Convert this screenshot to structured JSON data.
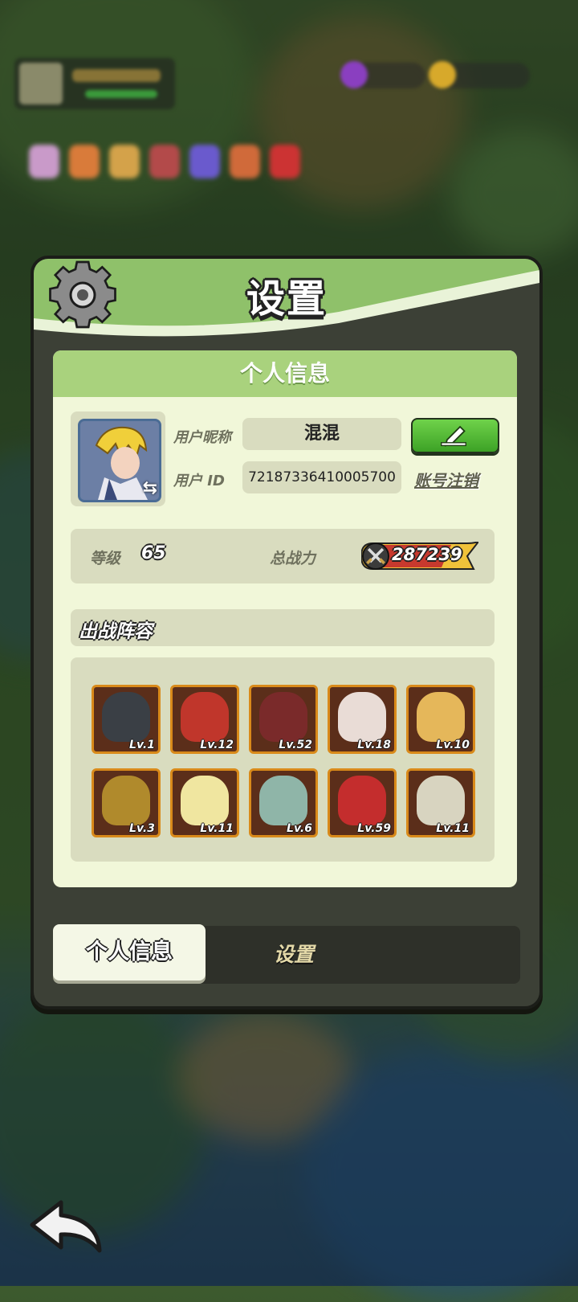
{
  "panel": {
    "title": "设置"
  },
  "profile": {
    "section_title": "个人信息",
    "nickname_label": "用户昵称",
    "nickname": "混混",
    "id_label": "用户 ID",
    "user_id": "72187336410005700",
    "deregister_label": "账号注销",
    "level_label": "等级",
    "level": "65",
    "power_label": "总战力",
    "power": "287239"
  },
  "lineup": {
    "title": "出战阵容",
    "heroes": [
      {
        "level": "Lv.1",
        "color": "#3a3f45"
      },
      {
        "level": "Lv.12",
        "color": "#c0362b"
      },
      {
        "level": "Lv.52",
        "color": "#7a2a2a"
      },
      {
        "level": "Lv.18",
        "color": "#e9dcd6"
      },
      {
        "level": "Lv.10",
        "color": "#e5b75a"
      },
      {
        "level": "Lv.3",
        "color": "#b08a2c"
      },
      {
        "level": "Lv.11",
        "color": "#f0e6a0"
      },
      {
        "level": "Lv.6",
        "color": "#8fb5a8"
      },
      {
        "level": "Lv.59",
        "color": "#c42d2d"
      },
      {
        "level": "Lv.11",
        "color": "#d8d4c0"
      }
    ]
  },
  "tabs": {
    "profile": "个人信息",
    "settings": "设置"
  },
  "icons": {
    "gear": "gear-icon",
    "edit": "pencil-icon",
    "back": "back-arrow-icon",
    "power": "crossed-swords-icon"
  },
  "colors": {
    "panel_green": "#8fc16a",
    "card_bg": "#f1f7d9",
    "hero_border": "#d98a1a"
  }
}
